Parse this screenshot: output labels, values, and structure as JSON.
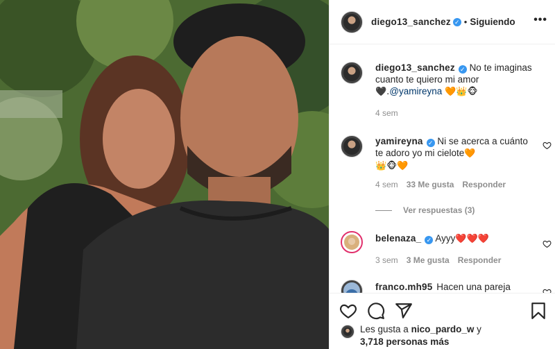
{
  "header": {
    "username": "diego13_sanchez",
    "verified_icon": "verified-badge-icon",
    "separator": "•",
    "follow_status": "Siguiendo",
    "more_icon": "more-options-icon",
    "more_glyph": "•••"
  },
  "caption": {
    "username": "diego13_sanchez",
    "text_1": "No te imaginas cuanto te quiero mi amor",
    "text_2": "🖤.",
    "mention": "@yamireyna",
    "emojis": "🧡👑🐵",
    "time": "4 sem"
  },
  "comments": [
    {
      "username": "yamireyna",
      "text": "Ni se acerca a cuánto te adoro yo mi cielote",
      "emoji_inline": "🧡",
      "emoji_line2": "👑🐵🧡",
      "time": "4 sem",
      "likes": "33 Me gusta",
      "reply": "Responder",
      "view_replies": "Ver respuestas (3)"
    },
    {
      "username": "belenaza_",
      "text": "Ayyy",
      "emojis": "❤️❤️❤️",
      "time": "3 sem",
      "likes": "3 Me gusta",
      "reply": "Responder"
    },
    {
      "username": "franco.mh95",
      "text": "Hacen una pareja"
    }
  ],
  "actions": {
    "like_icon": "heart-icon",
    "comment_icon": "comment-icon",
    "share_icon": "share-icon",
    "save_icon": "bookmark-icon"
  },
  "likes": {
    "prefix": "Les gusta a",
    "user": "nico_pardo_w",
    "suffix": "y",
    "count": "3,718 personas más"
  },
  "colors": {
    "verified": "#3897f0",
    "meta_gray": "#8e8e8e",
    "heart_red": "#ed4956",
    "story_ring": "#e1306c"
  }
}
